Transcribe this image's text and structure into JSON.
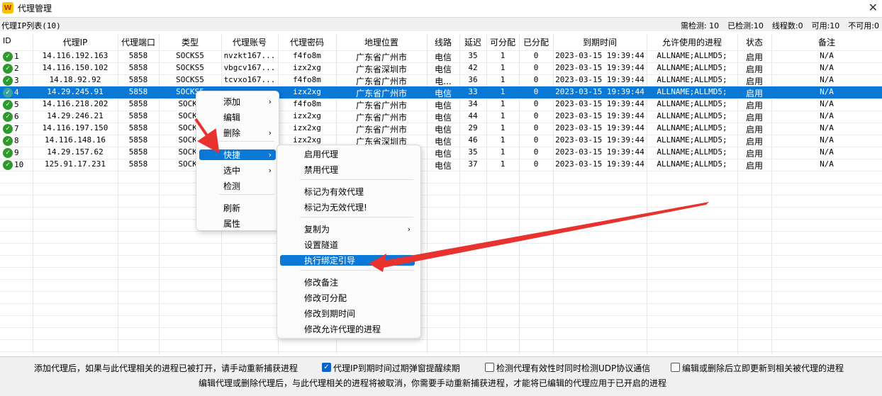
{
  "window": {
    "title": "代理管理",
    "close_glyph": "✕"
  },
  "list": {
    "title": "代理IP列表(10)"
  },
  "stats": [
    {
      "label": "需检测: 10"
    },
    {
      "label": "已检测:10"
    },
    {
      "label": "线程数:0"
    },
    {
      "label": "可用:10"
    },
    {
      "label": "不可用:0"
    }
  ],
  "columns": [
    "ID",
    "代理IP",
    "代理端口",
    "类型",
    "代理账号",
    "代理密码",
    "地理位置",
    "线路",
    "延迟",
    "可分配",
    "已分配",
    "到期时间",
    "允许使用的进程",
    "状态",
    "备注"
  ],
  "rows": [
    {
      "id": "1",
      "ip": "14.116.192.163",
      "port": "5858",
      "type": "SOCKS5",
      "account": "nvzkt167...",
      "password": "f4fo8m",
      "location": "广东省广州市",
      "line": "电信",
      "latency": "35",
      "assignable": "1",
      "assigned": "0",
      "expire": "2023-03-15 19:39:44",
      "process": "ALLNAME;ALLMD5;",
      "status": "启用",
      "remark": "N/A"
    },
    {
      "id": "2",
      "ip": "14.116.150.102",
      "port": "5858",
      "type": "SOCKS5",
      "account": "vbgcv167...",
      "password": "izx2xg",
      "location": "广东省深圳市",
      "line": "电信",
      "latency": "42",
      "assignable": "1",
      "assigned": "0",
      "expire": "2023-03-15 19:39:44",
      "process": "ALLNAME;ALLMD5;",
      "status": "启用",
      "remark": "N/A"
    },
    {
      "id": "3",
      "ip": "14.18.92.92",
      "port": "5858",
      "type": "SOCKS5",
      "account": "tcvxo167...",
      "password": "f4fo8m",
      "location": "广东省广州市",
      "line": "电...",
      "latency": "36",
      "assignable": "1",
      "assigned": "0",
      "expire": "2023-03-15 19:39:44",
      "process": "ALLNAME;ALLMD5;",
      "status": "启用",
      "remark": "N/A"
    },
    {
      "id": "4",
      "ip": "14.29.245.91",
      "port": "5858",
      "type": "SOCKS5",
      "account": "",
      "password": "izx2xg",
      "location": "广东省广州市",
      "line": "电信",
      "latency": "33",
      "assignable": "1",
      "assigned": "0",
      "expire": "2023-03-15 19:39:44",
      "process": "ALLNAME;ALLMD5;",
      "status": "启用",
      "remark": "N/A"
    },
    {
      "id": "5",
      "ip": "14.116.218.202",
      "port": "5858",
      "type": "SOCKS",
      "account": "",
      "password": "f4fo8m",
      "location": "广东省广州市",
      "line": "电信",
      "latency": "34",
      "assignable": "1",
      "assigned": "0",
      "expire": "2023-03-15 19:39:44",
      "process": "ALLNAME;ALLMD5;",
      "status": "启用",
      "remark": "N/A"
    },
    {
      "id": "6",
      "ip": "14.29.246.21",
      "port": "5858",
      "type": "SOCKS",
      "account": "",
      "password": "izx2xg",
      "location": "广东省广州市",
      "line": "电信",
      "latency": "44",
      "assignable": "1",
      "assigned": "0",
      "expire": "2023-03-15 19:39:44",
      "process": "ALLNAME;ALLMD5;",
      "status": "启用",
      "remark": "N/A"
    },
    {
      "id": "7",
      "ip": "14.116.197.150",
      "port": "5858",
      "type": "SOCKS",
      "account": "",
      "password": "izx2xg",
      "location": "广东省广州市",
      "line": "电信",
      "latency": "29",
      "assignable": "1",
      "assigned": "0",
      "expire": "2023-03-15 19:39:44",
      "process": "ALLNAME;ALLMD5;",
      "status": "启用",
      "remark": "N/A"
    },
    {
      "id": "8",
      "ip": "14.116.148.16",
      "port": "5858",
      "type": "SOCKS",
      "account": "",
      "password": "izx2xg",
      "location": "广东省深圳市",
      "line": "电信",
      "latency": "46",
      "assignable": "1",
      "assigned": "0",
      "expire": "2023-03-15 19:39:44",
      "process": "ALLNAME;ALLMD5;",
      "status": "启用",
      "remark": "N/A"
    },
    {
      "id": "9",
      "ip": "14.29.157.62",
      "port": "5858",
      "type": "SOCKS",
      "account": "",
      "password": "",
      "location": "",
      "line": "电信",
      "latency": "35",
      "assignable": "1",
      "assigned": "0",
      "expire": "2023-03-15 19:39:44",
      "process": "ALLNAME;ALLMD5;",
      "status": "启用",
      "remark": "N/A"
    },
    {
      "id": "10",
      "ip": "125.91.17.231",
      "port": "5858",
      "type": "SOCKS",
      "account": "",
      "password": "",
      "location": "",
      "line": "电信",
      "latency": "37",
      "assignable": "1",
      "assigned": "0",
      "expire": "2023-03-15 19:39:44",
      "process": "ALLNAME;ALLMD5;",
      "status": "启用",
      "remark": "N/A"
    }
  ],
  "context_menu": {
    "items": [
      {
        "label": "添加",
        "submenu": true
      },
      {
        "label": "编辑",
        "submenu": false
      },
      {
        "label": "删除",
        "submenu": true
      },
      {
        "label": "快捷",
        "submenu": true,
        "highlighted": true
      },
      {
        "label": "选中",
        "submenu": true
      },
      {
        "label": "检测",
        "submenu": false
      },
      {
        "label": "刷新",
        "submenu": false
      },
      {
        "label": "属性",
        "submenu": false
      }
    ]
  },
  "submenu": {
    "items": [
      {
        "label": "启用代理"
      },
      {
        "label": "禁用代理"
      },
      {
        "label": "标记为有效代理"
      },
      {
        "label": "标记为无效代理!"
      },
      {
        "label": "复制为",
        "submenu": true
      },
      {
        "label": "设置隧道"
      },
      {
        "label": "执行绑定引导",
        "highlighted": true
      },
      {
        "label": "修改备注"
      },
      {
        "label": "修改可分配"
      },
      {
        "label": "修改到期时间"
      },
      {
        "label": "修改允许代理的进程"
      }
    ]
  },
  "footer": {
    "note1": "添加代理后，如果与此代理相关的进程已被打开，请手动重新捕获进程",
    "opt_expire": {
      "label": "代理IP到期时间过期弹窗提醒续期",
      "checked": true
    },
    "opt_udp": {
      "label": "检测代理有效性时同时检测UDP协议通信",
      "checked": false
    },
    "opt_update": {
      "label": "编辑或删除后立即更新到相关被代理的进程",
      "checked": false
    },
    "note2": "编辑代理或删除代理后，与此代理相关的进程将被取消，你需要手动重新捕获进程，才能将已编辑的代理应用于已开启的进程"
  },
  "colors": {
    "selection": "#0a78d7",
    "arrow": "#e8322e",
    "check": "#2e9a2e"
  }
}
